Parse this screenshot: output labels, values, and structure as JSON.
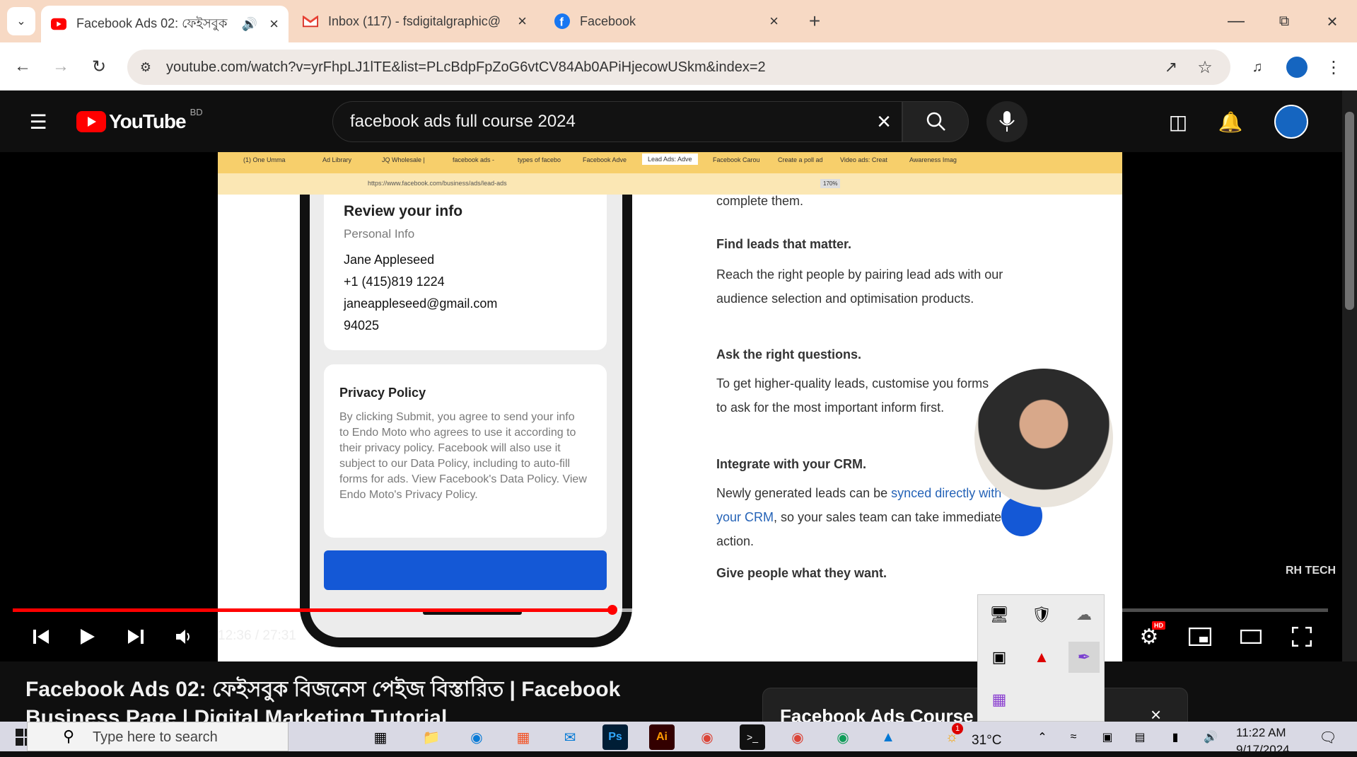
{
  "browser": {
    "tabs": [
      {
        "title": "Facebook Ads 02: ফেইসবুক",
        "icon": "youtube-icon",
        "active": true
      },
      {
        "title": "Inbox (117) - fsdigitalgraphic@",
        "icon": "gmail-icon",
        "active": false
      },
      {
        "title": "Facebook",
        "icon": "facebook-icon",
        "active": false
      }
    ],
    "url": "youtube.com/watch?v=yrFhpLJ1lTE&list=PLcBdpFpZoG6vtCV84Ab0APiHjecowUSkm&index=2"
  },
  "youtube": {
    "logo_text": "YouTube",
    "country": "BD",
    "search_query": "facebook ads full course 2024"
  },
  "video": {
    "inner_browser": {
      "tabs": [
        "(1) One Umma",
        "Ad Library",
        "JQ Wholesale |",
        "facebook ads -",
        "types of facebo",
        "Facebook Adve",
        "Lead Ads: Adve",
        "Facebook Carou",
        "Create a poll ad",
        "Video ads: Creat",
        "Awareness Imag"
      ],
      "url": "https://www.facebook.com/business/ads/lead-ads",
      "zoom": "170%"
    },
    "phone_card": {
      "heading": "Review your info",
      "subheading": "Personal Info",
      "name": "Jane Appleseed",
      "phone": "+1 (415)819 1224",
      "email": "janeappleseed@gmail.com",
      "zip": "94025"
    },
    "privacy": {
      "heading": "Privacy Policy",
      "text": "By clicking Submit, you agree to send your info to Endo Moto who agrees to use it according to their privacy policy. Facebook will also use it subject to our Data Policy, including to auto-fill forms for ads. View Facebook's Data Policy. View Endo Moto's Privacy Policy."
    },
    "article": {
      "top_line": "complete them.",
      "h1": "Find leads that matter.",
      "p1": "Reach the right people by pairing lead ads with our audience selection and optimisation products.",
      "h2": "Ask the right questions.",
      "p2": "To get higher-quality leads, customise you forms to ask for the most important inform first.",
      "h3": "Integrate with your CRM.",
      "p3_a": "Newly generated leads can be ",
      "p3_link": "synced directly with your CRM",
      "p3_b": ", so your sales team can take immediate action.",
      "h4": "Give people what they want."
    },
    "watermark": "RH TECH",
    "time": "12:36 / 27:31",
    "progress_fraction": 0.456,
    "hd_badge": "HD"
  },
  "below": {
    "title": "Facebook Ads 02: ফেইসবুক বিজনেস পেইজ বিস্তারিত | Facebook Business Page | Digital Marketing Tutorial",
    "playlist_title": "Facebook Ads Course"
  },
  "taskbar": {
    "search_placeholder": "Type here to search",
    "weather": "31°C",
    "time": "11:22 AM",
    "date": "9/17/2024",
    "weather_badge": "1"
  },
  "colors": {
    "tabstrip": "#f7d9c4",
    "youtube_red": "#ff0000",
    "inner_tab_bar": "#f7cf6b"
  }
}
